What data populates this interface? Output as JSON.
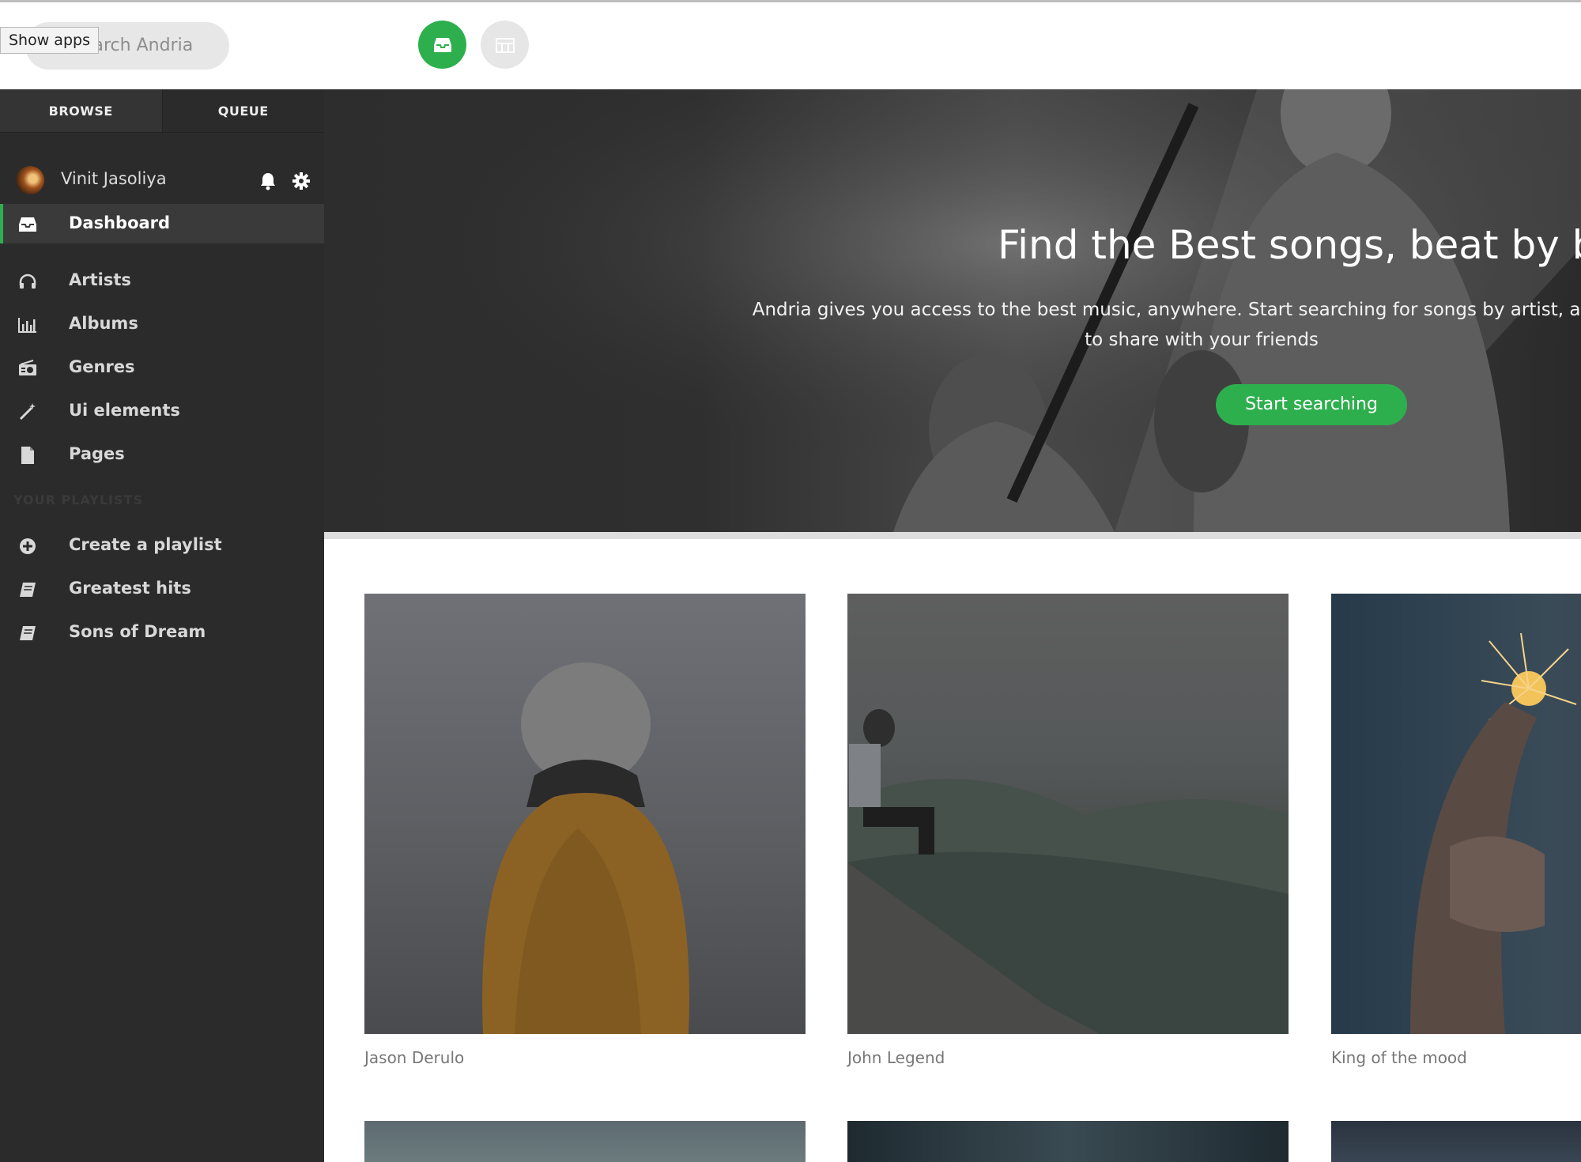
{
  "topbar": {
    "search_placeholder": "Search Andria",
    "tooltip": "Show apps",
    "buttons": [
      "inbox-icon",
      "calendar-icon"
    ]
  },
  "sidebar": {
    "tabs": [
      "BROWSE",
      "QUEUE"
    ],
    "user": {
      "name": "Vinit Jasoliya"
    },
    "nav": [
      {
        "label": "Dashboard",
        "icon": "inbox-icon",
        "active": true
      },
      {
        "label": "Artists",
        "icon": "headphones-icon"
      },
      {
        "label": "Albums",
        "icon": "bar-chart-icon"
      },
      {
        "label": "Genres",
        "icon": "radio-icon"
      },
      {
        "label": "Ui elements",
        "icon": "magic-wand-icon"
      },
      {
        "label": "Pages",
        "icon": "file-icon"
      }
    ],
    "playlists_heading": "YOUR PLAYLISTS",
    "playlists": [
      {
        "label": "Create a playlist",
        "icon": "plus-circle-icon"
      },
      {
        "label": "Greatest hits",
        "icon": "book-icon"
      },
      {
        "label": "Sons of Dream",
        "icon": "book-icon"
      }
    ]
  },
  "hero": {
    "title": "Find the Best songs, beat by beat",
    "text_line1": "Andria gives you access to the best music, anywhere. Start searching for songs by artist, album or",
    "text_line2": "to share with your friends",
    "button": "Start searching"
  },
  "cards": [
    {
      "caption": "Jason Derulo"
    },
    {
      "caption": "John Legend"
    },
    {
      "caption": "King of the mood"
    }
  ],
  "colors": {
    "accent": "#2eaf4e",
    "sidebar": "#2b2b2b"
  }
}
